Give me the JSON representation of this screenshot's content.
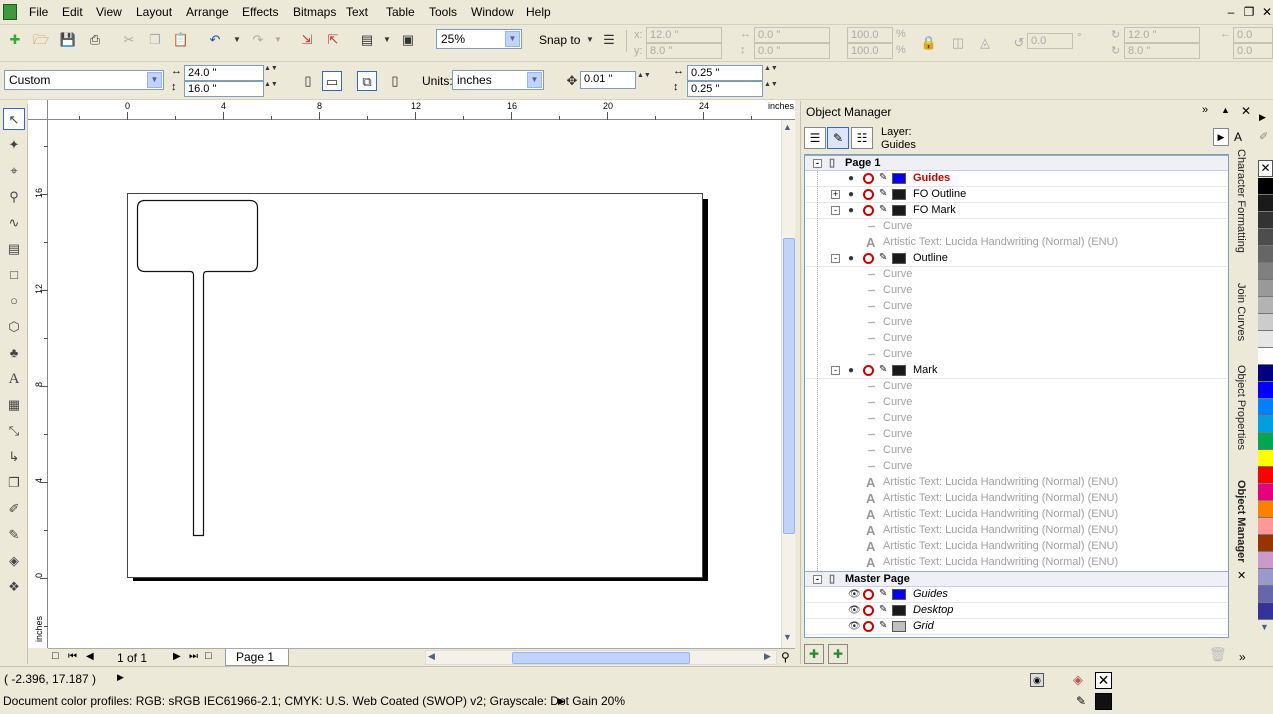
{
  "menu": [
    "File",
    "Edit",
    "View",
    "Layout",
    "Arrange",
    "Effects",
    "Bitmaps",
    "Text",
    "Table",
    "Tools",
    "Window",
    "Help"
  ],
  "toolbar1": {
    "zoom": "25%",
    "snap_label": "Snap to",
    "x_label": "x:",
    "x_value": "12.0 \"",
    "y_label": "y:",
    "y_value": "8.0 \"",
    "w_value": "0.0 \"",
    "h_value": "0.0 \"",
    "sx_value": "100.0",
    "sy_value": "100.0",
    "pct1": "%",
    "pct2": "%",
    "rot_value": "0.0",
    "deg": "°",
    "cx_value": "12.0 \"",
    "cy_value": "8.0 \"",
    "right1": "0.0",
    "right2": "0.0"
  },
  "toolbar2": {
    "page_preset": "Custom",
    "page_width": "24.0 \"",
    "page_height": "16.0 \"",
    "units_label": "Units:",
    "units_value": "inches",
    "nudge": "0.01 \"",
    "dup_x": "0.25 \"",
    "dup_y": "0.25 \""
  },
  "ruler": {
    "units": "inches",
    "h_ticks": [
      "0",
      "4",
      "8",
      "12",
      "16",
      "20",
      "24"
    ],
    "v_ticks": [
      "16",
      "12",
      "8",
      "4",
      "0"
    ],
    "v_units": "inches"
  },
  "page_nav": {
    "count": "1 of 1",
    "tab": "Page 1"
  },
  "object_manager": {
    "title": "Object Manager",
    "layer_label": "Layer:",
    "layer_name": "Guides",
    "rows": [
      {
        "kind": "page",
        "text": "Page 1"
      },
      {
        "kind": "layer",
        "text": "Guides",
        "color": "#0000ff",
        "style": "guides"
      },
      {
        "kind": "layer",
        "text": "FO Outline",
        "color": "#1a1a1a",
        "style": "plain",
        "exp": "+"
      },
      {
        "kind": "layer",
        "text": "FO Mark",
        "color": "#1a1a1a",
        "style": "plain",
        "exp": "-"
      },
      {
        "kind": "child",
        "icon": "curve",
        "text": "Curve"
      },
      {
        "kind": "child",
        "icon": "text",
        "text": "Artistic Text: Lucida Handwriting (Normal) (ENU)"
      },
      {
        "kind": "layer",
        "text": "Outline",
        "color": "#1a1a1a",
        "style": "plain",
        "exp": "-"
      },
      {
        "kind": "child",
        "icon": "curve",
        "text": "Curve"
      },
      {
        "kind": "child",
        "icon": "curve",
        "text": "Curve"
      },
      {
        "kind": "child",
        "icon": "curve",
        "text": "Curve"
      },
      {
        "kind": "child",
        "icon": "curve",
        "text": "Curve"
      },
      {
        "kind": "child",
        "icon": "curve",
        "text": "Curve"
      },
      {
        "kind": "child",
        "icon": "curve",
        "text": "Curve"
      },
      {
        "kind": "layer",
        "text": "Mark",
        "color": "#1a1a1a",
        "style": "plain",
        "exp": "-"
      },
      {
        "kind": "child",
        "icon": "curve",
        "text": "Curve"
      },
      {
        "kind": "child",
        "icon": "curve",
        "text": "Curve"
      },
      {
        "kind": "child",
        "icon": "curve",
        "text": "Curve"
      },
      {
        "kind": "child",
        "icon": "curve",
        "text": "Curve"
      },
      {
        "kind": "child",
        "icon": "curve",
        "text": "Curve"
      },
      {
        "kind": "child",
        "icon": "curve",
        "text": "Curve"
      },
      {
        "kind": "child",
        "icon": "text",
        "text": "Artistic Text: Lucida Handwriting (Normal) (ENU)"
      },
      {
        "kind": "child",
        "icon": "text",
        "text": "Artistic Text: Lucida Handwriting (Normal) (ENU)"
      },
      {
        "kind": "child",
        "icon": "text",
        "text": "Artistic Text: Lucida Handwriting (Normal) (ENU)"
      },
      {
        "kind": "child",
        "icon": "text",
        "text": "Artistic Text: Lucida Handwriting (Normal) (ENU)"
      },
      {
        "kind": "child",
        "icon": "text",
        "text": "Artistic Text: Lucida Handwriting (Normal) (ENU)"
      },
      {
        "kind": "child",
        "icon": "text",
        "text": "Artistic Text: Lucida Handwriting (Normal) (ENU)"
      },
      {
        "kind": "page",
        "text": "Master Page"
      },
      {
        "kind": "master",
        "text": "Guides",
        "color": "#0000ff"
      },
      {
        "kind": "master",
        "text": "Desktop",
        "color": "#1a1a1a"
      },
      {
        "kind": "master",
        "text": "Grid",
        "color": "#c0c0c0"
      }
    ]
  },
  "docker_tabs": [
    "Character Formatting",
    "Join Curves",
    "Object Properties",
    "Object Manager"
  ],
  "palette": [
    "#000000",
    "#1a1a1a",
    "#333333",
    "#4d4d4d",
    "#666666",
    "#808080",
    "#999999",
    "#b3b3b3",
    "#cccccc",
    "#e6e6e6",
    "#ffffff",
    "#000080",
    "#0000ff",
    "#0080ff",
    "#00a0e0",
    "#00a651",
    "#ffff00",
    "#ff0000",
    "#e6007e",
    "#ff8000",
    "#ff9999",
    "#993300",
    "#cc99cc",
    "#9999cc",
    "#6666aa",
    "#333399"
  ],
  "status": {
    "coords": "( -2.396, 17.187 )",
    "profiles": "Document color profiles: RGB: sRGB IEC61966-2.1; CMYK: U.S. Web Coated (SWOP) v2; Grayscale: Dot Gain 20%"
  }
}
